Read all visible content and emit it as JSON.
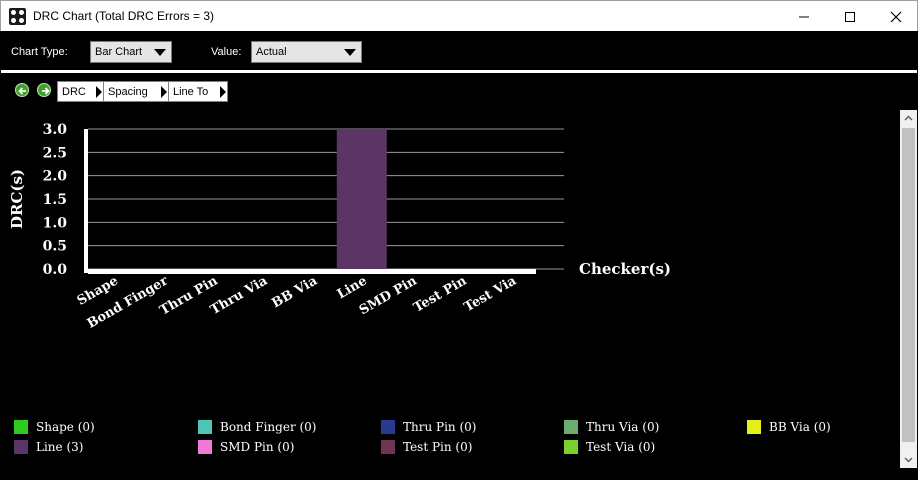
{
  "window": {
    "title": "DRC Chart (Total DRC Errors = 3)",
    "icon": "drc-app-icon",
    "controls": [
      "minimize-icon",
      "maximize-icon",
      "close-icon"
    ]
  },
  "toolbar": {
    "chart_type_label": "Chart Type:",
    "chart_type_value": "Bar Chart",
    "value_label": "Value:",
    "value_value": "Actual"
  },
  "navigation": {
    "back_icon": "arrow-left-icon",
    "forward_icon": "arrow-right-icon",
    "breadcrumb": [
      "DRC",
      "Spacing",
      "Line To"
    ]
  },
  "chart_data": {
    "type": "bar",
    "categories": [
      "Shape",
      "Bond Finger",
      "Thru Pin",
      "Thru Via",
      "BB Via",
      "Line",
      "SMD Pin",
      "Test Pin",
      "Test Via"
    ],
    "values": [
      0,
      0,
      0,
      0,
      0,
      3,
      0,
      0,
      0
    ],
    "colors": [
      "#2ecc1e",
      "#4ec5b6",
      "#2b3a8f",
      "#6aad6f",
      "#e5f01b",
      "#5a3566",
      "#f07ad7",
      "#6e3450",
      "#7ad12d"
    ],
    "xlabel": "Checker(s)",
    "ylabel": "DRC(s)",
    "ylim": [
      0,
      3
    ],
    "yticks": [
      "0.0",
      "0.5",
      "1.0",
      "1.5",
      "2.0",
      "2.5",
      "3.0"
    ],
    "grid": true,
    "legend_position": "bottom"
  },
  "legend": [
    {
      "label": "Shape (0)",
      "color": "#2ecc1e"
    },
    {
      "label": "Bond Finger (0)",
      "color": "#4ec5b6"
    },
    {
      "label": "Thru Pin (0)",
      "color": "#2b3a8f"
    },
    {
      "label": "Thru Via (0)",
      "color": "#6aad6f"
    },
    {
      "label": "BB Via (0)",
      "color": "#e5f01b"
    },
    {
      "label": "Line (3)",
      "color": "#5a3566"
    },
    {
      "label": "SMD Pin (0)",
      "color": "#f07ad7"
    },
    {
      "label": "Test Pin (0)",
      "color": "#6e3450"
    },
    {
      "label": "Test Via (0)",
      "color": "#7ad12d"
    }
  ]
}
